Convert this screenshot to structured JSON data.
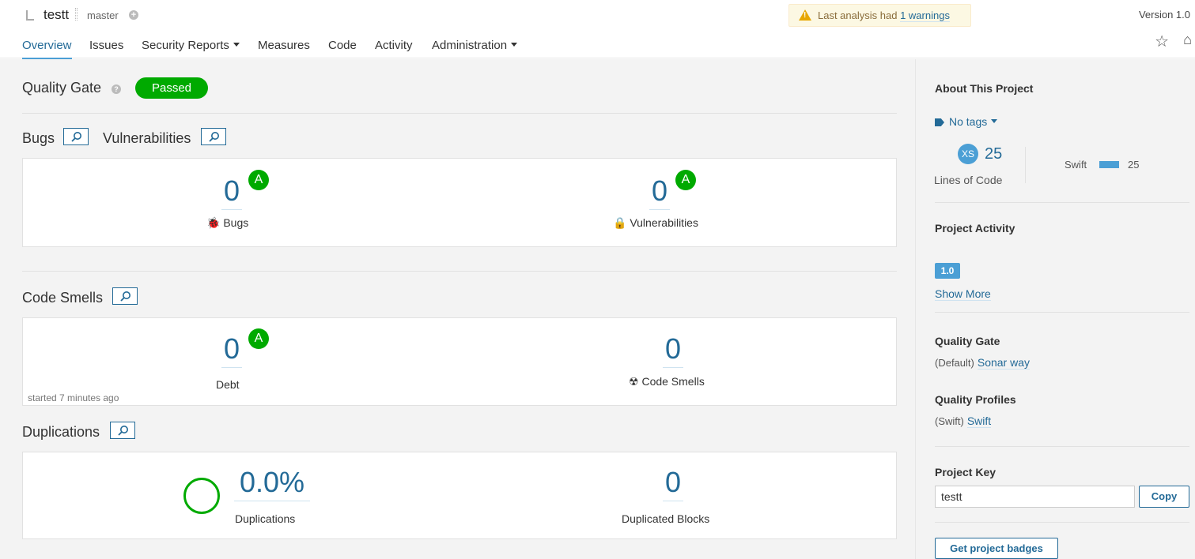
{
  "header": {
    "project_name": "testt",
    "branch": "master",
    "warning_prefix": "Last analysis had",
    "warning_link": "1 warnings",
    "version": "Version 1.0"
  },
  "nav": {
    "items": [
      "Overview",
      "Issues",
      "Security Reports",
      "Measures",
      "Code",
      "Activity",
      "Administration"
    ]
  },
  "main": {
    "quality_gate_title": "Quality Gate",
    "quality_gate_status": "Passed",
    "bugs_title": "Bugs",
    "vulns_title": "Vulnerabilities",
    "bugs": {
      "value": "0",
      "rating": "A",
      "label": "Bugs"
    },
    "vulnerabilities": {
      "value": "0",
      "rating": "A",
      "label": "Vulnerabilities"
    },
    "code_smells_title": "Code Smells",
    "debt": {
      "value": "0",
      "rating": "A",
      "label": "Debt"
    },
    "code_smells": {
      "value": "0",
      "label": "Code Smells"
    },
    "started": "started 7 minutes ago",
    "duplications_title": "Duplications",
    "duplications": {
      "value": "0.0%",
      "label": "Duplications"
    },
    "duplicated_blocks": {
      "value": "0",
      "label": "Duplicated Blocks"
    }
  },
  "sidebar": {
    "about_title": "About This Project",
    "tags": "No tags",
    "loc_badge": "XS",
    "loc_value": "25",
    "loc_label": "Lines of Code",
    "language": "Swift",
    "language_loc": "25",
    "activity_title": "Project Activity",
    "version_badge": "1.0",
    "show_more": "Show More",
    "qg_title": "Quality Gate",
    "qg_prefix": "(Default)",
    "qg_name": "Sonar way",
    "profiles_title": "Quality Profiles",
    "profile_prefix": "(Swift)",
    "profile_name": "Swift",
    "key_title": "Project Key",
    "key_value": "testt",
    "copy_label": "Copy",
    "badges_label": "Get project badges"
  },
  "colors": {
    "accent": "#236a97",
    "passed": "#00aa00",
    "rating_a": "#00aa00",
    "bar": "#4b9fd5"
  }
}
